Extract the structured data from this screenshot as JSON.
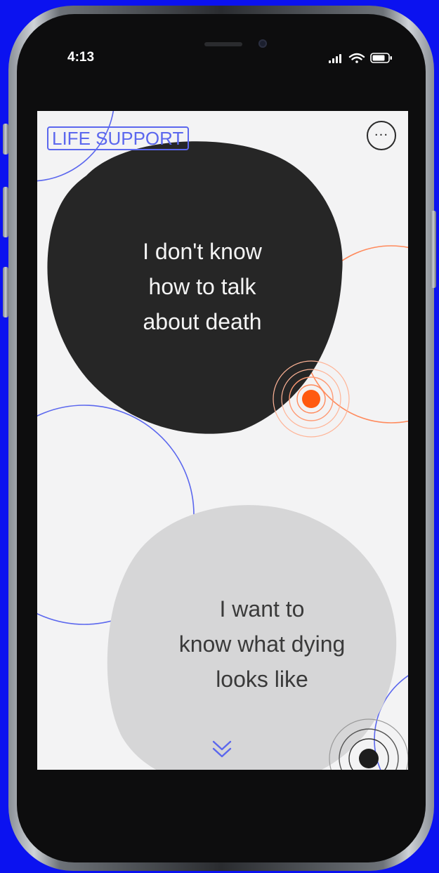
{
  "status_bar": {
    "time": "4:13"
  },
  "logo": {
    "text": "LIFE SUPPORT"
  },
  "menu": {
    "icon": "more-horizontal-icon",
    "label": "···"
  },
  "cards": [
    {
      "text": "I don't know\nhow to talk\nabout death",
      "tone": "dark"
    },
    {
      "text": "I want to\nknow what dying\nlooks like",
      "tone": "light"
    }
  ],
  "scroll_hint": {
    "icon": "double-chevron-down-icon"
  },
  "colors": {
    "frame_bg": "#0b12f0",
    "screen_bg": "#f3f3f4",
    "accent_blue": "#5b67ee",
    "accent_orange": "#ff5a10",
    "dark_blob": "#262626",
    "light_blob": "#d6d6d7"
  }
}
